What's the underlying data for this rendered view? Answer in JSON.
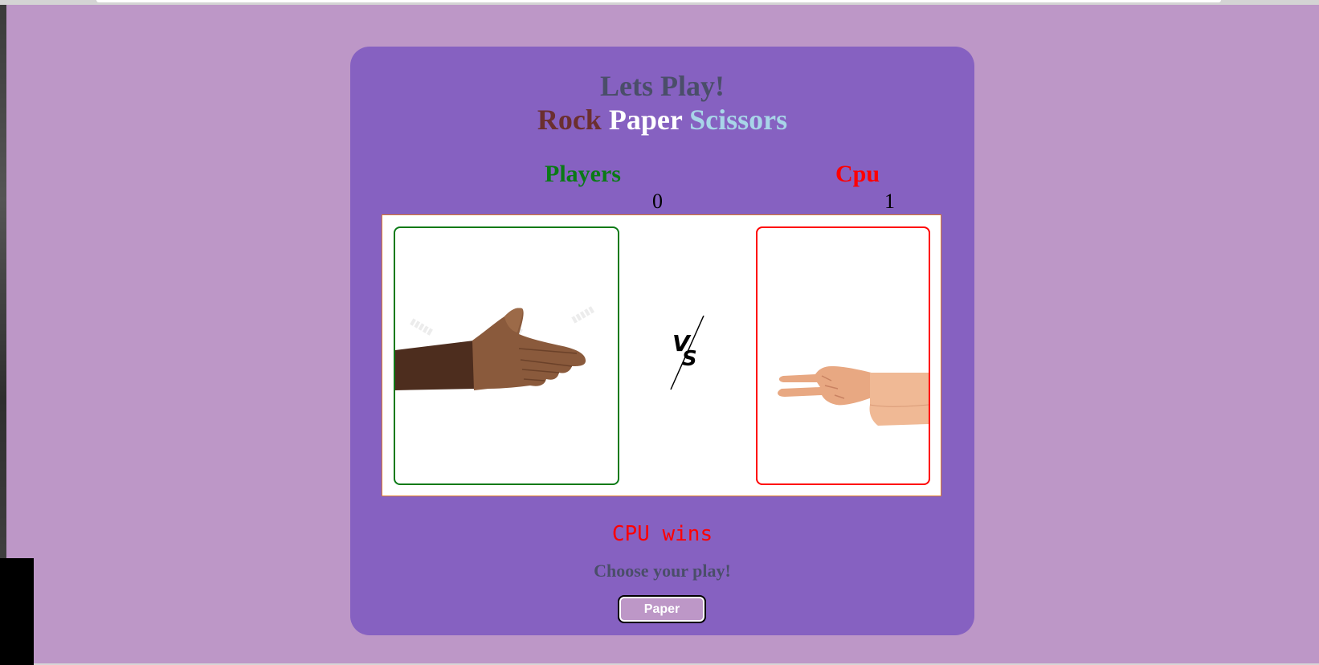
{
  "header": {
    "line1": "Lets Play!",
    "word_rock": "Rock",
    "word_paper": "Paper",
    "word_scissors": "Scissors"
  },
  "scoreboard": {
    "player_label": "Players",
    "cpu_label": "Cpu",
    "player_score": "0",
    "cpu_score": "1"
  },
  "arena": {
    "player_hand": "paper-hand-icon",
    "cpu_hand": "scissors-hand-icon",
    "vs_icon": "vs-icon"
  },
  "result": {
    "text": "CPU wins"
  },
  "controls": {
    "prompt": "Choose your play!",
    "play_button_label": "Paper"
  },
  "colors": {
    "background": "#bd97c7",
    "card": "#8661c1",
    "player": "#0a7a16",
    "cpu": "#ff0000",
    "rock": "#6b2f2f",
    "paper": "#ffffff",
    "scissors": "#a8d5e8"
  }
}
